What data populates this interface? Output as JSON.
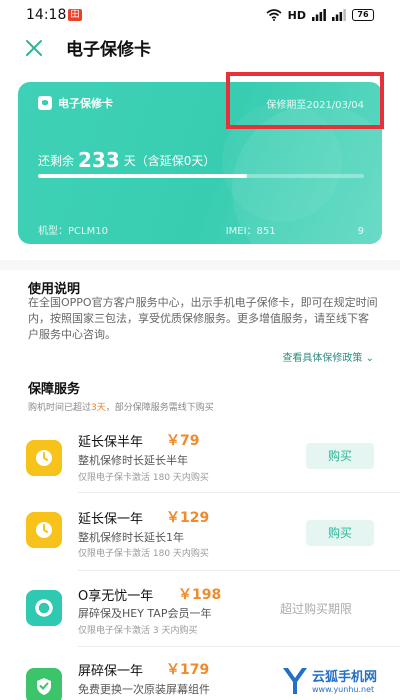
{
  "status_bar": {
    "time": "14:18",
    "notification_badge": "田",
    "network": "HD",
    "battery": "76"
  },
  "header": {
    "title": "电子保修卡"
  },
  "card": {
    "title": "电子保修卡",
    "expiry": "保修期至2021/03/04",
    "remaining_prefix": "还剩余",
    "remaining_days": "233",
    "remaining_suffix": "天（含延保0天）",
    "progress": 0.64,
    "model": "机型：PCLM10",
    "imei": "IMEI：851",
    "imei_tail": "9",
    "color_start": "#3fd1b5",
    "color_end": "#5fd9c2"
  },
  "usage": {
    "title": "使用说明",
    "text": "在全国OPPO官方客户服务中心，出示手机电子保修卡，即可在规定时间内，按照国家三包法，享受优质保修服务。更多增值服务，请至线下客户服务中心咨询。",
    "policy_link": "查看具体保修政策"
  },
  "services": {
    "title": "保障服务",
    "subtitle_prefix": "购机时间已超过",
    "subtitle_warn": "3天",
    "subtitle_suffix": "，部分保障服务需线下购买",
    "items": [
      {
        "name": "延长保半年",
        "price": "￥79",
        "desc": "整机保修时长延长半年",
        "note": "仅限电子保卡激活 180 天内购买",
        "action": "购买",
        "icon": "clock-icon",
        "icon_color": "#f7c21a"
      },
      {
        "name": "延长保一年",
        "price": "￥129",
        "desc": "整机保修时长延长1年",
        "note": "仅限电子保卡激活 180 天内购买",
        "action": "购买",
        "icon": "clock-icon",
        "icon_color": "#f7c21a"
      },
      {
        "name": "O享无忧一年",
        "price": "￥198",
        "desc": "屏碎保及HEY TAP会员一年",
        "note": "仅限电子保卡激活 3 天内购买",
        "action": "超过购买期限",
        "icon": "ring-icon",
        "icon_color": "#2ec9b0"
      },
      {
        "name": "屏碎保一年",
        "price": "￥179",
        "desc": "免费更换一次原装屏幕组件",
        "icon": "shield-icon",
        "icon_color": "#3cc46a"
      }
    ]
  },
  "watermark": {
    "name": "云狐手机网",
    "url": "www.yunhu.net"
  },
  "colors": {
    "accent": "#38cdb1",
    "price": "#f08a2a",
    "highlight": "#e8303a",
    "link": "#2f8b7f"
  }
}
